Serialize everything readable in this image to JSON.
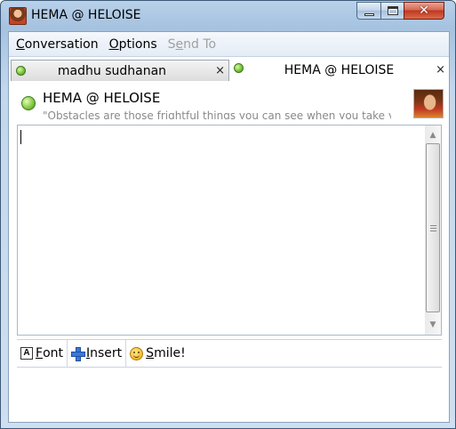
{
  "window": {
    "title": "HEMA @ HELOISE",
    "controls": {
      "minimize": "minimize-icon",
      "maximize": "maximize-icon",
      "close": "close-icon"
    }
  },
  "menu": {
    "items": [
      {
        "pre": "",
        "accel": "C",
        "post": "onversation",
        "enabled": true
      },
      {
        "pre": "",
        "accel": "O",
        "post": "ptions",
        "enabled": true
      },
      {
        "pre": "S",
        "accel": "e",
        "post": "nd To",
        "enabled": false
      }
    ]
  },
  "tabs": [
    {
      "label": "madhu sudhanan",
      "close": "×",
      "active": false,
      "status_color": "#6cbf2e"
    },
    {
      "label": "HEMA @ HELOISE",
      "close": "×",
      "active": true,
      "status_color": "#6cbf2e"
    }
  ],
  "contact": {
    "name": "HEMA @ HELOISE",
    "status_message": "\"Obstacles are those frightful things you can see when you take yo",
    "status": "online",
    "status_color": "#6cbf2e"
  },
  "toolbar": {
    "font": {
      "accel": "F",
      "rest": "ont",
      "icon": "A"
    },
    "insert": {
      "accel": "I",
      "rest": "nsert"
    },
    "smile": {
      "accel": "S",
      "rest": "mile!"
    }
  },
  "colors": {
    "frame": "#b9d1ea",
    "close_button": "#c0371f",
    "online": "#6cbf2e"
  }
}
